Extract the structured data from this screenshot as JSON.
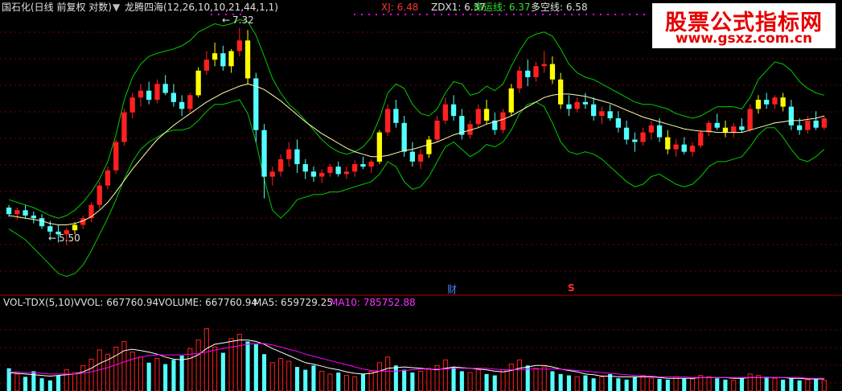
{
  "header": {
    "stock": "国石化(日线 前复权 对数)",
    "indicator": "龙腾四海(12,26,10,10,21,44,1,1)",
    "xj": "XJ: 6.48",
    "zdx1": "ZDX1: 6.37",
    "myx": "命运线: 6.37",
    "dkx": "多空线: 6.58"
  },
  "watermark": {
    "title": "股票公式指标网",
    "url": "www.gsxz.com.cn"
  },
  "price_labels": {
    "high": "7.32",
    "low": "5.50"
  },
  "markers": {
    "cai": "财",
    "s": "S"
  },
  "volume_header": {
    "name": "VOL-TDX(5,10)",
    "vvol": "VVOL: 667760.94",
    "volume": "VOLUME: 667760.94",
    "ma5": "MA5: 659729.25",
    "ma10": "MA10: 785752.88"
  },
  "colors": {
    "up": "#ff2020",
    "down": "#54ffff",
    "yellow": "#ffff00",
    "green": "#00cc00",
    "ma": "#ffffb0",
    "grid": "#7a0000",
    "ma10": "#ff00ff",
    "volma": "#ffffff"
  },
  "chart_data": [
    {
      "type": "candlestick",
      "title": "龙腾四海(12,26,10,10,21,44,1,1)",
      "scale": "log",
      "ylim": [
        5.2,
        7.45
      ],
      "ohlc": [
        [
          5.78,
          5.8,
          5.71,
          5.73
        ],
        [
          5.73,
          5.78,
          5.69,
          5.76
        ],
        [
          5.76,
          5.8,
          5.7,
          5.72
        ],
        [
          5.72,
          5.75,
          5.66,
          5.7
        ],
        [
          5.7,
          5.73,
          5.62,
          5.64
        ],
        [
          5.64,
          5.68,
          5.57,
          5.6
        ],
        [
          5.6,
          5.65,
          5.52,
          5.58
        ],
        [
          5.58,
          5.63,
          5.5,
          5.61
        ],
        [
          5.61,
          5.67,
          5.58,
          5.65
        ],
        [
          5.65,
          5.72,
          5.62,
          5.7
        ],
        [
          5.7,
          5.82,
          5.67,
          5.8
        ],
        [
          5.8,
          5.98,
          5.77,
          5.95
        ],
        [
          5.95,
          6.1,
          5.92,
          6.07
        ],
        [
          6.07,
          6.32,
          6.04,
          6.3
        ],
        [
          6.3,
          6.58,
          6.27,
          6.55
        ],
        [
          6.55,
          6.72,
          6.5,
          6.68
        ],
        [
          6.68,
          6.8,
          6.6,
          6.74
        ],
        [
          6.74,
          6.82,
          6.62,
          6.66
        ],
        [
          6.66,
          6.84,
          6.63,
          6.8
        ],
        [
          6.8,
          6.88,
          6.7,
          6.72
        ],
        [
          6.72,
          6.8,
          6.6,
          6.64
        ],
        [
          6.64,
          6.7,
          6.52,
          6.58
        ],
        [
          6.58,
          6.72,
          6.55,
          6.7
        ],
        [
          6.7,
          6.95,
          6.68,
          6.92
        ],
        [
          6.92,
          7.1,
          6.88,
          7.02
        ],
        [
          7.02,
          7.18,
          6.96,
          7.08
        ],
        [
          7.08,
          7.15,
          6.92,
          6.96
        ],
        [
          6.96,
          7.12,
          6.9,
          7.1
        ],
        [
          7.1,
          7.32,
          7.05,
          7.2
        ],
        [
          7.2,
          7.3,
          6.8,
          6.85
        ],
        [
          6.85,
          6.9,
          6.3,
          6.4
        ],
        [
          6.4,
          6.45,
          5.85,
          6.02
        ],
        [
          6.02,
          6.1,
          5.95,
          6.06
        ],
        [
          6.06,
          6.2,
          6.02,
          6.16
        ],
        [
          6.16,
          6.3,
          6.1,
          6.24
        ],
        [
          6.24,
          6.32,
          6.05,
          6.12
        ],
        [
          6.12,
          6.16,
          6.0,
          6.06
        ],
        [
          6.06,
          6.1,
          5.98,
          6.02
        ],
        [
          6.02,
          6.08,
          5.97,
          6.05
        ],
        [
          6.05,
          6.12,
          6.02,
          6.1
        ],
        [
          6.1,
          6.14,
          6.02,
          6.04
        ],
        [
          6.04,
          6.1,
          6.0,
          6.06
        ],
        [
          6.06,
          6.15,
          6.02,
          6.12
        ],
        [
          6.12,
          6.18,
          6.08,
          6.1
        ],
        [
          6.1,
          6.16,
          6.05,
          6.14
        ],
        [
          6.14,
          6.4,
          6.12,
          6.38
        ],
        [
          6.38,
          6.62,
          6.35,
          6.58
        ],
        [
          6.58,
          6.66,
          6.42,
          6.46
        ],
        [
          6.46,
          6.52,
          6.18,
          6.22
        ],
        [
          6.22,
          6.3,
          6.1,
          6.14
        ],
        [
          6.14,
          6.24,
          6.08,
          6.2
        ],
        [
          6.2,
          6.35,
          6.17,
          6.32
        ],
        [
          6.32,
          6.52,
          6.3,
          6.48
        ],
        [
          6.48,
          6.68,
          6.45,
          6.62
        ],
        [
          6.62,
          6.7,
          6.48,
          6.52
        ],
        [
          6.52,
          6.58,
          6.32,
          6.36
        ],
        [
          6.36,
          6.48,
          6.33,
          6.45
        ],
        [
          6.45,
          6.62,
          6.42,
          6.58
        ],
        [
          6.58,
          6.66,
          6.45,
          6.48
        ],
        [
          6.48,
          6.55,
          6.36,
          6.4
        ],
        [
          6.4,
          6.58,
          6.37,
          6.55
        ],
        [
          6.55,
          6.8,
          6.52,
          6.76
        ],
        [
          6.76,
          6.96,
          6.72,
          6.92
        ],
        [
          6.92,
          7.02,
          6.78,
          6.86
        ],
        [
          6.86,
          7.0,
          6.82,
          6.96
        ],
        [
          6.96,
          7.1,
          6.9,
          6.98
        ],
        [
          6.98,
          7.05,
          6.8,
          6.84
        ],
        [
          6.84,
          6.9,
          6.58,
          6.62
        ],
        [
          6.62,
          6.7,
          6.52,
          6.58
        ],
        [
          6.58,
          6.68,
          6.55,
          6.64
        ],
        [
          6.64,
          6.72,
          6.58,
          6.62
        ],
        [
          6.62,
          6.68,
          6.48,
          6.52
        ],
        [
          6.52,
          6.6,
          6.45,
          6.56
        ],
        [
          6.56,
          6.62,
          6.48,
          6.5
        ],
        [
          6.5,
          6.56,
          6.38,
          6.42
        ],
        [
          6.42,
          6.48,
          6.28,
          6.32
        ],
        [
          6.32,
          6.38,
          6.22,
          6.3
        ],
        [
          6.3,
          6.42,
          6.27,
          6.38
        ],
        [
          6.38,
          6.48,
          6.32,
          6.44
        ],
        [
          6.44,
          6.5,
          6.3,
          6.34
        ],
        [
          6.34,
          6.4,
          6.2,
          6.24
        ],
        [
          6.24,
          6.32,
          6.18,
          6.28
        ],
        [
          6.28,
          6.34,
          6.2,
          6.22
        ],
        [
          6.22,
          6.3,
          6.18,
          6.27
        ],
        [
          6.27,
          6.4,
          6.25,
          6.38
        ],
        [
          6.38,
          6.48,
          6.35,
          6.46
        ],
        [
          6.46,
          6.54,
          6.4,
          6.42
        ],
        [
          6.42,
          6.48,
          6.34,
          6.38
        ],
        [
          6.38,
          6.46,
          6.34,
          6.43
        ],
        [
          6.43,
          6.5,
          6.38,
          6.4
        ],
        [
          6.4,
          6.62,
          6.38,
          6.58
        ],
        [
          6.58,
          6.7,
          6.54,
          6.66
        ],
        [
          6.66,
          6.72,
          6.58,
          6.62
        ],
        [
          6.62,
          6.7,
          6.58,
          6.68
        ],
        [
          6.68,
          6.72,
          6.56,
          6.6
        ],
        [
          6.6,
          6.66,
          6.4,
          6.44
        ],
        [
          6.44,
          6.5,
          6.36,
          6.4
        ],
        [
          6.4,
          6.52,
          6.37,
          6.48
        ],
        [
          6.48,
          6.56,
          6.4,
          6.42
        ],
        [
          6.42,
          6.52,
          6.4,
          6.5
        ]
      ],
      "yellow_bars": [
        8,
        23,
        25,
        27,
        29,
        45,
        51,
        58,
        61,
        66,
        67,
        80,
        87,
        91,
        94
      ],
      "moving_average": {
        "name": "多空线",
        "values": [
          5.72,
          5.71,
          5.7,
          5.69,
          5.68,
          5.66,
          5.65,
          5.65,
          5.66,
          5.68,
          5.71,
          5.76,
          5.82,
          5.9,
          5.99,
          6.08,
          6.16,
          6.24,
          6.32,
          6.38,
          6.44,
          6.49,
          6.54,
          6.59,
          6.64,
          6.68,
          6.72,
          6.75,
          6.78,
          6.8,
          6.78,
          6.75,
          6.7,
          6.65,
          6.59,
          6.53,
          6.47,
          6.42,
          6.37,
          6.33,
          6.29,
          6.25,
          6.22,
          6.2,
          6.18,
          6.18,
          6.19,
          6.21,
          6.23,
          6.24,
          6.26,
          6.28,
          6.3,
          6.33,
          6.36,
          6.38,
          6.4,
          6.42,
          6.45,
          6.47,
          6.49,
          6.52,
          6.56,
          6.6,
          6.64,
          6.68,
          6.7,
          6.71,
          6.71,
          6.7,
          6.69,
          6.67,
          6.65,
          6.63,
          6.6,
          6.57,
          6.54,
          6.51,
          6.49,
          6.47,
          6.45,
          6.43,
          6.41,
          6.4,
          6.39,
          6.39,
          6.38,
          6.38,
          6.38,
          6.38,
          6.4,
          6.42,
          6.44,
          6.46,
          6.47,
          6.48,
          6.48,
          6.49,
          6.5,
          6.52
        ]
      },
      "band_upper": [
        5.84,
        5.82,
        5.8,
        5.78,
        5.75,
        5.72,
        5.7,
        5.72,
        5.76,
        5.82,
        5.9,
        6.0,
        6.14,
        6.36,
        6.66,
        6.86,
        6.98,
        7.05,
        7.08,
        7.1,
        7.12,
        7.15,
        7.2,
        7.28,
        7.32,
        7.36,
        7.34,
        7.36,
        7.4,
        7.38,
        7.25,
        7.05,
        6.85,
        6.72,
        6.62,
        6.56,
        6.48,
        6.4,
        6.32,
        6.26,
        6.22,
        6.2,
        6.22,
        6.26,
        6.34,
        6.5,
        6.72,
        6.8,
        6.76,
        6.62,
        6.54,
        6.52,
        6.58,
        6.72,
        6.82,
        6.8,
        6.7,
        6.72,
        6.78,
        6.74,
        6.8,
        6.96,
        7.1,
        7.22,
        7.26,
        7.28,
        7.24,
        7.12,
        6.98,
        6.9,
        6.86,
        6.84,
        6.8,
        6.76,
        6.72,
        6.68,
        6.64,
        6.62,
        6.62,
        6.6,
        6.58,
        6.54,
        6.52,
        6.5,
        6.52,
        6.56,
        6.6,
        6.6,
        6.6,
        6.58,
        6.68,
        6.84,
        6.92,
        7.0,
        6.98,
        6.92,
        6.82,
        6.76,
        6.72,
        6.7
      ],
      "band_lower": [
        5.62,
        5.58,
        5.54,
        5.48,
        5.42,
        5.36,
        5.3,
        5.28,
        5.3,
        5.36,
        5.46,
        5.58,
        5.7,
        5.84,
        6.0,
        6.14,
        6.24,
        6.3,
        6.34,
        6.38,
        6.4,
        6.4,
        6.42,
        6.48,
        6.56,
        6.62,
        6.62,
        6.64,
        6.66,
        6.54,
        6.3,
        6.0,
        5.76,
        5.7,
        5.76,
        5.84,
        5.86,
        5.88,
        5.88,
        5.9,
        5.9,
        5.92,
        5.94,
        5.96,
        5.98,
        6.04,
        6.14,
        6.1,
        5.98,
        5.92,
        5.94,
        6.02,
        6.14,
        6.26,
        6.3,
        6.24,
        6.18,
        6.22,
        6.28,
        6.26,
        6.3,
        6.4,
        6.54,
        6.62,
        6.64,
        6.6,
        6.46,
        6.3,
        6.22,
        6.2,
        6.22,
        6.2,
        6.16,
        6.1,
        6.04,
        5.98,
        5.94,
        5.96,
        6.02,
        6.04,
        6.0,
        5.96,
        5.94,
        5.96,
        6.02,
        6.1,
        6.14,
        6.14,
        6.16,
        6.18,
        6.26,
        6.36,
        6.42,
        6.42,
        6.34,
        6.24,
        6.16,
        6.14,
        6.18,
        6.24
      ]
    },
    {
      "type": "bar",
      "title": "VOL-TDX(5,10)",
      "volume_norm": [
        0.32,
        0.24,
        0.2,
        0.28,
        0.18,
        0.15,
        0.22,
        0.3,
        0.26,
        0.36,
        0.45,
        0.58,
        0.52,
        0.62,
        0.7,
        0.55,
        0.48,
        0.4,
        0.46,
        0.38,
        0.44,
        0.5,
        0.6,
        0.72,
        0.88,
        0.62,
        0.54,
        0.74,
        0.8,
        0.7,
        0.66,
        0.52,
        0.4,
        0.46,
        0.42,
        0.34,
        0.3,
        0.36,
        0.28,
        0.24,
        0.26,
        0.22,
        0.2,
        0.24,
        0.28,
        0.4,
        0.48,
        0.36,
        0.3,
        0.26,
        0.28,
        0.32,
        0.36,
        0.44,
        0.34,
        0.28,
        0.26,
        0.3,
        0.24,
        0.22,
        0.3,
        0.38,
        0.44,
        0.36,
        0.32,
        0.34,
        0.28,
        0.24,
        0.22,
        0.2,
        0.22,
        0.18,
        0.2,
        0.24,
        0.18,
        0.16,
        0.2,
        0.22,
        0.18,
        0.17,
        0.16,
        0.2,
        0.18,
        0.17,
        0.22,
        0.2,
        0.18,
        0.16,
        0.15,
        0.18,
        0.24,
        0.22,
        0.2,
        0.18,
        0.16,
        0.18,
        0.15,
        0.16,
        0.18,
        0.15
      ],
      "ma5_norm": [
        0.26,
        0.25,
        0.24,
        0.23,
        0.22,
        0.21,
        0.22,
        0.23,
        0.24,
        0.27,
        0.32,
        0.39,
        0.44,
        0.5,
        0.57,
        0.59,
        0.57,
        0.55,
        0.52,
        0.48,
        0.45,
        0.44,
        0.46,
        0.51,
        0.6,
        0.66,
        0.68,
        0.7,
        0.72,
        0.72,
        0.7,
        0.66,
        0.6,
        0.55,
        0.5,
        0.45,
        0.4,
        0.38,
        0.35,
        0.32,
        0.3,
        0.27,
        0.25,
        0.24,
        0.25,
        0.28,
        0.32,
        0.33,
        0.34,
        0.33,
        0.32,
        0.31,
        0.3,
        0.32,
        0.34,
        0.33,
        0.32,
        0.31,
        0.3,
        0.28,
        0.27,
        0.29,
        0.32,
        0.34,
        0.36,
        0.36,
        0.34,
        0.31,
        0.29,
        0.27,
        0.24,
        0.23,
        0.21,
        0.21,
        0.2,
        0.2,
        0.2,
        0.2,
        0.2,
        0.19,
        0.18,
        0.18,
        0.18,
        0.18,
        0.19,
        0.19,
        0.19,
        0.19,
        0.18,
        0.18,
        0.19,
        0.19,
        0.19,
        0.19,
        0.19,
        0.18,
        0.18,
        0.17,
        0.17,
        0.17
      ],
      "ma10_norm": [
        0.27,
        0.27,
        0.26,
        0.26,
        0.25,
        0.24,
        0.24,
        0.24,
        0.24,
        0.25,
        0.27,
        0.3,
        0.33,
        0.37,
        0.41,
        0.45,
        0.48,
        0.5,
        0.51,
        0.51,
        0.51,
        0.51,
        0.52,
        0.53,
        0.55,
        0.58,
        0.6,
        0.62,
        0.64,
        0.66,
        0.67,
        0.67,
        0.65,
        0.62,
        0.59,
        0.56,
        0.52,
        0.49,
        0.46,
        0.43,
        0.4,
        0.37,
        0.34,
        0.31,
        0.29,
        0.28,
        0.28,
        0.28,
        0.29,
        0.3,
        0.31,
        0.31,
        0.31,
        0.31,
        0.32,
        0.32,
        0.32,
        0.32,
        0.32,
        0.31,
        0.3,
        0.3,
        0.3,
        0.31,
        0.31,
        0.31,
        0.31,
        0.31,
        0.3,
        0.29,
        0.28,
        0.27,
        0.26,
        0.25,
        0.24,
        0.23,
        0.22,
        0.21,
        0.21,
        0.2,
        0.2,
        0.2,
        0.2,
        0.19,
        0.19,
        0.19,
        0.19,
        0.19,
        0.19,
        0.19,
        0.19,
        0.19,
        0.19,
        0.19,
        0.19,
        0.19,
        0.19,
        0.18,
        0.18,
        0.18
      ]
    }
  ]
}
